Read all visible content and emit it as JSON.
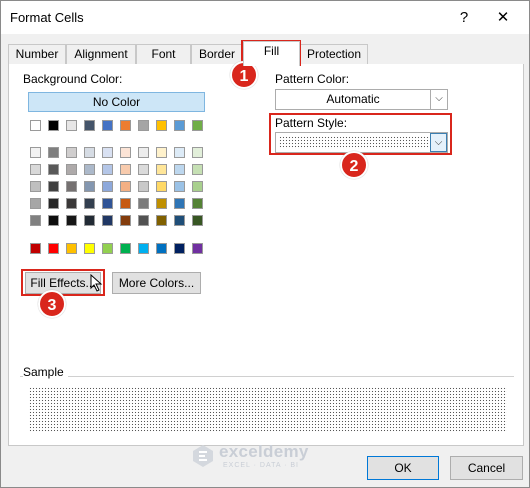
{
  "window": {
    "title": "Format Cells",
    "help": "?",
    "close": "✕"
  },
  "tabs": [
    {
      "label": "Number"
    },
    {
      "label": "Alignment"
    },
    {
      "label": "Font"
    },
    {
      "label": "Border"
    },
    {
      "label": "Fill"
    },
    {
      "label": "Protection"
    }
  ],
  "active_tab": "Fill",
  "background": {
    "label": "Background Color:",
    "no_color": "No Color",
    "theme_row": [
      "#ffffff",
      "#000000",
      "#e7e6e6",
      "#44546a",
      "#4472c4",
      "#ed7d31",
      "#a5a5a5",
      "#ffc000",
      "#5b9bd5",
      "#70ad47"
    ],
    "tint_rows": [
      [
        "#f2f2f2",
        "#7f7f7f",
        "#d0cece",
        "#d6dce4",
        "#d9e1f2",
        "#fce4d6",
        "#ededed",
        "#fff2cc",
        "#ddebf7",
        "#e2efda"
      ],
      [
        "#d9d9d9",
        "#595959",
        "#aeaaaa",
        "#acb9ca",
        "#b4c6e7",
        "#f8cbad",
        "#dbdbdb",
        "#ffe699",
        "#bdd7ee",
        "#c6e0b4"
      ],
      [
        "#bfbfbf",
        "#404040",
        "#757171",
        "#8497b0",
        "#8ea9db",
        "#f4b084",
        "#c9c9c9",
        "#ffd966",
        "#9bc2e6",
        "#a9d08e"
      ],
      [
        "#a6a6a6",
        "#262626",
        "#3a3838",
        "#333f4f",
        "#305496",
        "#c65911",
        "#7b7b7b",
        "#bf8f00",
        "#2f75b5",
        "#548235"
      ],
      [
        "#808080",
        "#0d0d0d",
        "#161616",
        "#222b35",
        "#203764",
        "#833c0c",
        "#525252",
        "#806000",
        "#1f4e78",
        "#375623"
      ]
    ],
    "standard_row": [
      "#c00000",
      "#ff0000",
      "#ffc000",
      "#ffff00",
      "#92d050",
      "#00b050",
      "#00b0f0",
      "#0070c0",
      "#002060",
      "#7030a0"
    ],
    "fill_effects": "Fill Effects...",
    "more_colors": "More Colors..."
  },
  "pattern": {
    "color_label": "Pattern Color:",
    "color_value": "Automatic",
    "style_label": "Pattern Style:"
  },
  "sample": {
    "label": "Sample"
  },
  "footer": {
    "ok": "OK",
    "cancel": "Cancel"
  },
  "callouts": {
    "one": "1",
    "two": "2",
    "three": "3"
  },
  "watermark": {
    "name": "exceldemy",
    "tagline": "EXCEL · DATA · BI"
  },
  "colors": {
    "highlight_red": "#d9261c",
    "selection_blue": "#cde6f7"
  }
}
